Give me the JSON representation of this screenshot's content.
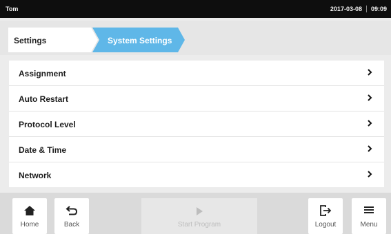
{
  "status_bar": {
    "user": "Tom",
    "date": "2017-03-08",
    "time": "09:09"
  },
  "breadcrumb": {
    "items": [
      "Settings",
      "System Settings"
    ]
  },
  "settings_list": {
    "items": [
      {
        "label": "Assignment"
      },
      {
        "label": "Auto Restart"
      },
      {
        "label": "Protocol Level"
      },
      {
        "label": "Date & Time"
      },
      {
        "label": "Network"
      }
    ]
  },
  "bottom_bar": {
    "home_label": "Home",
    "back_label": "Back",
    "start_label": "Start Program",
    "logout_label": "Logout",
    "menu_label": "Menu"
  },
  "colors": {
    "accent": "#5fb7e8",
    "status_bar": "#0e0e0e"
  },
  "icons": {
    "home": "home-icon",
    "back": "back-arrow-icon",
    "start": "play-icon",
    "logout": "logout-icon",
    "menu": "hamburger-icon",
    "row": "chevron-right-icon"
  }
}
